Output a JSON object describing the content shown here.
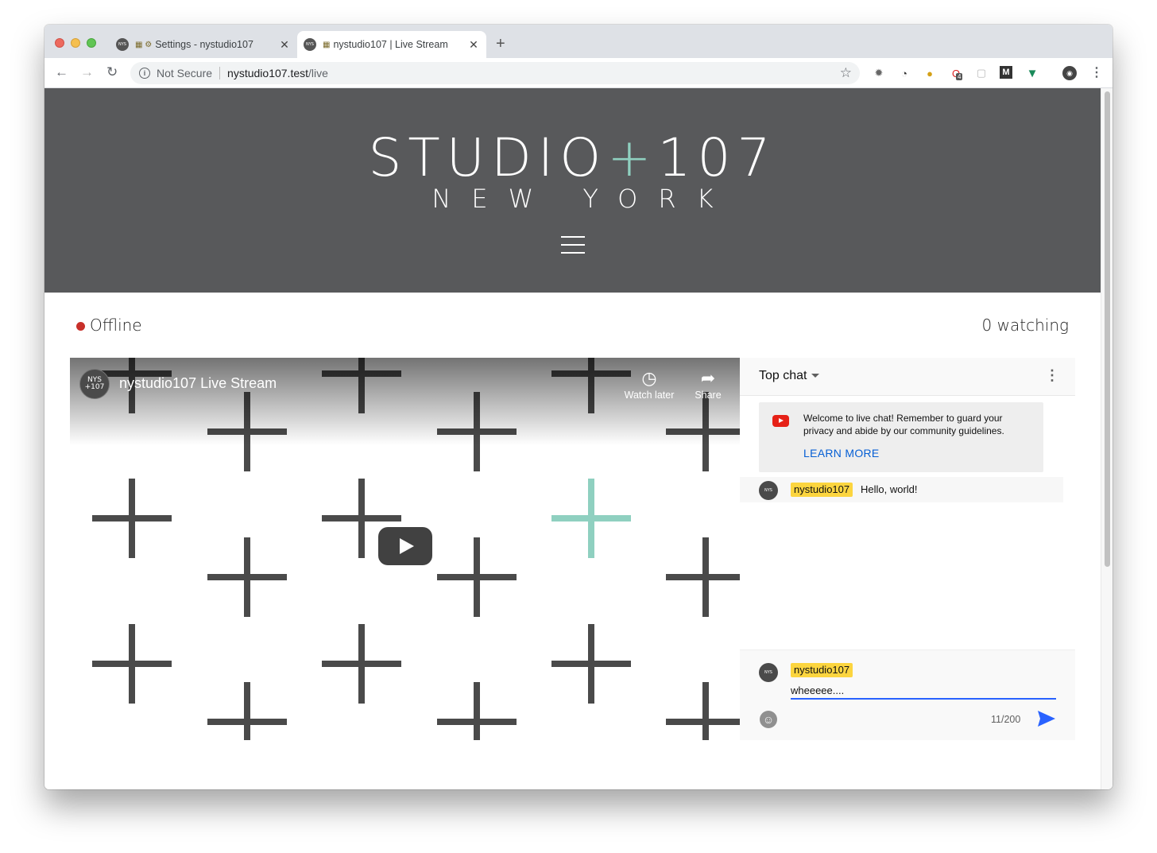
{
  "browser": {
    "tabs": [
      {
        "title": "Settings - nystudio107",
        "active": false
      },
      {
        "title": "nystudio107 | Live Stream",
        "active": true
      }
    ],
    "address": {
      "security_label": "Not Secure",
      "host": "nystudio107.test",
      "path": "/live"
    },
    "extension_badge": "4"
  },
  "site": {
    "logo_main": "STUDIO",
    "logo_plus": "+",
    "logo_num": "107",
    "logo_sub": "NEW YORK"
  },
  "stream": {
    "status": "Offline",
    "watching": "0 watching"
  },
  "player": {
    "channel_avatar_text": "NYS +107",
    "title": "nystudio107 Live Stream",
    "watch_later": "Watch later",
    "share": "Share"
  },
  "chat": {
    "mode": "Top chat",
    "welcome_text": "Welcome to live chat! Remember to guard your privacy and abide by our community guidelines.",
    "learn_more": "LEARN MORE",
    "messages": [
      {
        "author": "nystudio107",
        "text": "Hello, world!"
      }
    ],
    "input": {
      "author": "nystudio107",
      "value": "wheeeee....",
      "count": "11/200"
    }
  },
  "colors": {
    "hero_bg": "#58595b",
    "accent_teal": "#8fd0c0",
    "offline_dot": "#c8302a",
    "author_chip": "#fcd53f",
    "link_blue": "#065fd4"
  }
}
